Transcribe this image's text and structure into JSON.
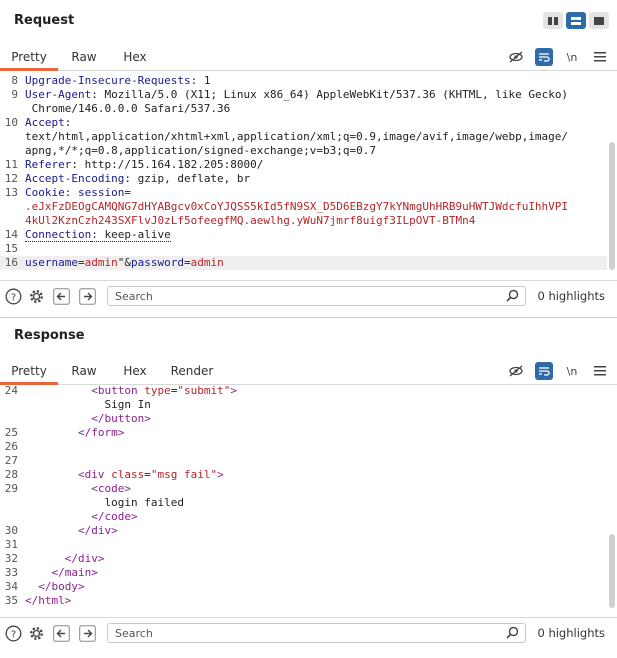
{
  "request": {
    "title": "Request",
    "tabs": [
      "Pretty",
      "Raw",
      "Hex"
    ],
    "lines": [
      {
        "n": "8",
        "parts": [
          [
            "Upgrade-Insecure-Requests",
            "k-blue"
          ],
          [
            ": 1",
            "k-dark"
          ]
        ]
      },
      {
        "n": "9",
        "parts": [
          [
            "User-Agent",
            "k-blue"
          ],
          [
            ": Mozilla/5.0 (X11; Linux x86_64) AppleWebKit/537.36 (KHTML, like Gecko)",
            "k-dark"
          ]
        ]
      },
      {
        "n": "",
        "parts": [
          [
            " Chrome/146.0.0.0 Safari/537.36",
            "k-dark"
          ]
        ]
      },
      {
        "n": "10",
        "parts": [
          [
            "Accept",
            "k-blue"
          ],
          [
            ":",
            "k-dark"
          ]
        ]
      },
      {
        "n": "",
        "parts": [
          [
            "text/html,application/xhtml+xml,application/xml;q=0.9,image/avif,image/webp,image/",
            "k-dark"
          ]
        ]
      },
      {
        "n": "",
        "parts": [
          [
            "apng,*/*;q=0.8,application/signed-exchange;v=b3;q=0.7",
            "k-dark"
          ]
        ]
      },
      {
        "n": "11",
        "parts": [
          [
            "Referer",
            "k-blue"
          ],
          [
            ": http://15.164.182.205:8000/",
            "k-dark"
          ]
        ]
      },
      {
        "n": "12",
        "parts": [
          [
            "Accept-Encoding",
            "k-blue"
          ],
          [
            ": gzip, deflate, br",
            "k-dark"
          ]
        ]
      },
      {
        "n": "13",
        "parts": [
          [
            "Cookie",
            "k-blue"
          ],
          [
            ": ",
            "k-dark"
          ],
          [
            "session",
            "k-blue"
          ],
          [
            "=",
            "k-dark"
          ]
        ]
      },
      {
        "n": "",
        "parts": [
          [
            ".eJxFzDEOgCAMQNG7dHYABgcv0xCoYJQSS5kId5fN9SX_D5D6EBzgY7kYNmgUhHRB9uHWTJWdcfuIhhVPI",
            "k-red"
          ]
        ]
      },
      {
        "n": "",
        "parts": [
          [
            "4kUl2KznCzh243SXFlvJ0zLf5ofeegfMQ.aewlhg.yWuN7jmrf8uigf3ILpOVT-BTMn4",
            "k-red"
          ]
        ]
      },
      {
        "n": "14",
        "parts": [
          [
            "Connection",
            "k-blue dotted"
          ],
          [
            ": keep-alive",
            "k-dark dotted"
          ]
        ]
      },
      {
        "n": "15",
        "parts": []
      },
      {
        "n": "16",
        "parts": [
          [
            "username",
            "k-blue"
          ],
          [
            "=",
            "k-dark"
          ],
          [
            "admin",
            "k-red"
          ],
          [
            "\"",
            "k-dark"
          ],
          [
            "&",
            "k-dark"
          ],
          [
            "password",
            "k-blue"
          ],
          [
            "=",
            "k-dark"
          ],
          [
            "admin",
            "k-red"
          ]
        ],
        "current": true
      }
    ],
    "search_placeholder": "Search",
    "highlights": "0 highlights"
  },
  "response": {
    "title": "Response",
    "tabs": [
      "Pretty",
      "Raw",
      "Hex",
      "Render"
    ],
    "lines": [
      {
        "n": "24",
        "parts": [
          [
            "          <",
            "k-mag"
          ],
          [
            "button ",
            "k-mag"
          ],
          [
            "type",
            "k-red"
          ],
          [
            "=",
            "k-dark"
          ],
          [
            "\"submit\"",
            "k-red"
          ],
          [
            ">",
            "k-mag"
          ]
        ]
      },
      {
        "n": "",
        "parts": [
          [
            "            Sign In",
            "k-dark"
          ]
        ]
      },
      {
        "n": "",
        "parts": [
          [
            "          </",
            "k-mag"
          ],
          [
            "button",
            "k-mag"
          ],
          [
            ">",
            "k-mag"
          ]
        ]
      },
      {
        "n": "25",
        "parts": [
          [
            "        </",
            "k-mag"
          ],
          [
            "form",
            "k-mag"
          ],
          [
            ">",
            "k-mag"
          ]
        ]
      },
      {
        "n": "26",
        "parts": []
      },
      {
        "n": "27",
        "parts": []
      },
      {
        "n": "28",
        "parts": [
          [
            "        <",
            "k-mag"
          ],
          [
            "div ",
            "k-mag"
          ],
          [
            "class",
            "k-red"
          ],
          [
            "=",
            "k-dark"
          ],
          [
            "\"msg fail\"",
            "k-red"
          ],
          [
            ">",
            "k-mag"
          ]
        ]
      },
      {
        "n": "29",
        "parts": [
          [
            "          <",
            "k-mag"
          ],
          [
            "code",
            "k-mag"
          ],
          [
            ">",
            "k-mag"
          ]
        ]
      },
      {
        "n": "",
        "parts": [
          [
            "            login failed",
            "k-dark"
          ]
        ]
      },
      {
        "n": "",
        "parts": [
          [
            "          </",
            "k-mag"
          ],
          [
            "code",
            "k-mag"
          ],
          [
            ">",
            "k-mag"
          ]
        ]
      },
      {
        "n": "30",
        "parts": [
          [
            "        </",
            "k-mag"
          ],
          [
            "div",
            "k-mag"
          ],
          [
            ">",
            "k-mag"
          ]
        ]
      },
      {
        "n": "31",
        "parts": []
      },
      {
        "n": "32",
        "parts": [
          [
            "      </",
            "k-mag"
          ],
          [
            "div",
            "k-mag"
          ],
          [
            ">",
            "k-mag"
          ]
        ]
      },
      {
        "n": "33",
        "parts": [
          [
            "    </",
            "k-mag"
          ],
          [
            "main",
            "k-mag"
          ],
          [
            ">",
            "k-mag"
          ]
        ]
      },
      {
        "n": "34",
        "parts": [
          [
            "  </",
            "k-mag"
          ],
          [
            "body",
            "k-mag"
          ],
          [
            ">",
            "k-mag"
          ]
        ]
      },
      {
        "n": "35",
        "parts": [
          [
            "</",
            "k-mag"
          ],
          [
            "html",
            "k-mag"
          ],
          [
            ">",
            "k-mag"
          ]
        ]
      }
    ],
    "search_placeholder": "Search",
    "highlights": "0 highlights"
  },
  "tools": {
    "newline_label": "\\n"
  },
  "colors": {
    "accent_tab": "#e8663a",
    "active_button": "#2f6ba8"
  }
}
